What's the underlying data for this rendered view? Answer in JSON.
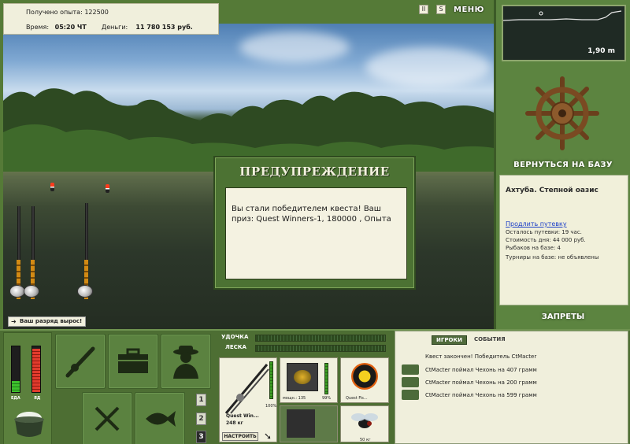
{
  "header": {
    "xp_label": "Получено опыта: 122500",
    "time_label": "Время:",
    "time_value": "05:20 ЧТ",
    "money_label": "Деньги:",
    "money_value": "11 780 153 руб.",
    "menu_label": "МЕНЮ",
    "pause_label": "II",
    "sound_label": "S"
  },
  "depth_panel": {
    "value": "1,90 m"
  },
  "base": {
    "return_label": "ВЕРНУТЬСЯ НА БАЗУ",
    "place": "Ахтуба. Степной оазис",
    "extend_link": "Продлить путевку",
    "lines": [
      "Осталось путевки: 19 час.",
      "Стоимость дня: 44 000 руб.",
      "Рыбаков на базе: 4",
      "Турниры на базе: не объявлены"
    ],
    "bans_label": "ЗАПРЕТЫ"
  },
  "rank_notice": "Ваш разряд вырос!",
  "dialog": {
    "title": "ПРЕДУПРЕЖДЕНИЕ",
    "message": "Вы стали победителем квеста! Ваш приз: Quest Winners-1, 180000 , Опыта"
  },
  "gauges": {
    "food_label": "ЕДА",
    "poison_label": "ЯД",
    "food_level": 0.25,
    "poison_level": 0.95
  },
  "pages": [
    "1",
    "2",
    "3"
  ],
  "tackle": {
    "rod_label": "УДОЧКА",
    "line_label": "ЛЕСКА",
    "rod_name": "Quest Win...",
    "rod_weight": "248 кг",
    "rod_percent": "100%",
    "reel_power": "мощн.: 135",
    "reel_percent": "99%",
    "line_name": "Quest Fis...",
    "lure_weight": "50 кг",
    "setup_label": "НАСТРОИТЬ"
  },
  "events": {
    "tabs": [
      "ИГРОКИ",
      "СОБЫТИЯ"
    ],
    "items": [
      "Квест закончен! Победитель CtMacter",
      "CtMacter поймал Чехонь на 407 грамм",
      "CtMacter поймал Чехонь на 200 грамм",
      "CtMacter поймал Чехонь на 599 грамм"
    ]
  },
  "colors": {
    "panel_green": "#557a37",
    "dialog_green": "#4c7233",
    "paper": "#f0efdc",
    "link_blue": "#1b3ec8"
  }
}
